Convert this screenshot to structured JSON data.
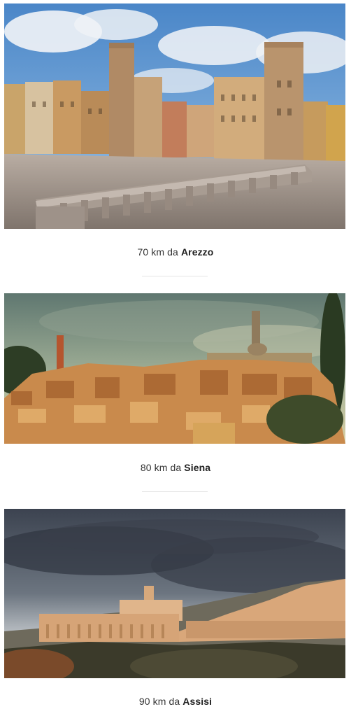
{
  "destinations": [
    {
      "distance": "70 km da",
      "city": "Arezzo",
      "image_alt": "Piazza Grande, Arezzo"
    },
    {
      "distance": "80 km da",
      "city": "Siena",
      "image_alt": "Siena skyline at sunset"
    },
    {
      "distance": "90 km da",
      "city": "Assisi",
      "image_alt": "Assisi hillside town"
    }
  ]
}
